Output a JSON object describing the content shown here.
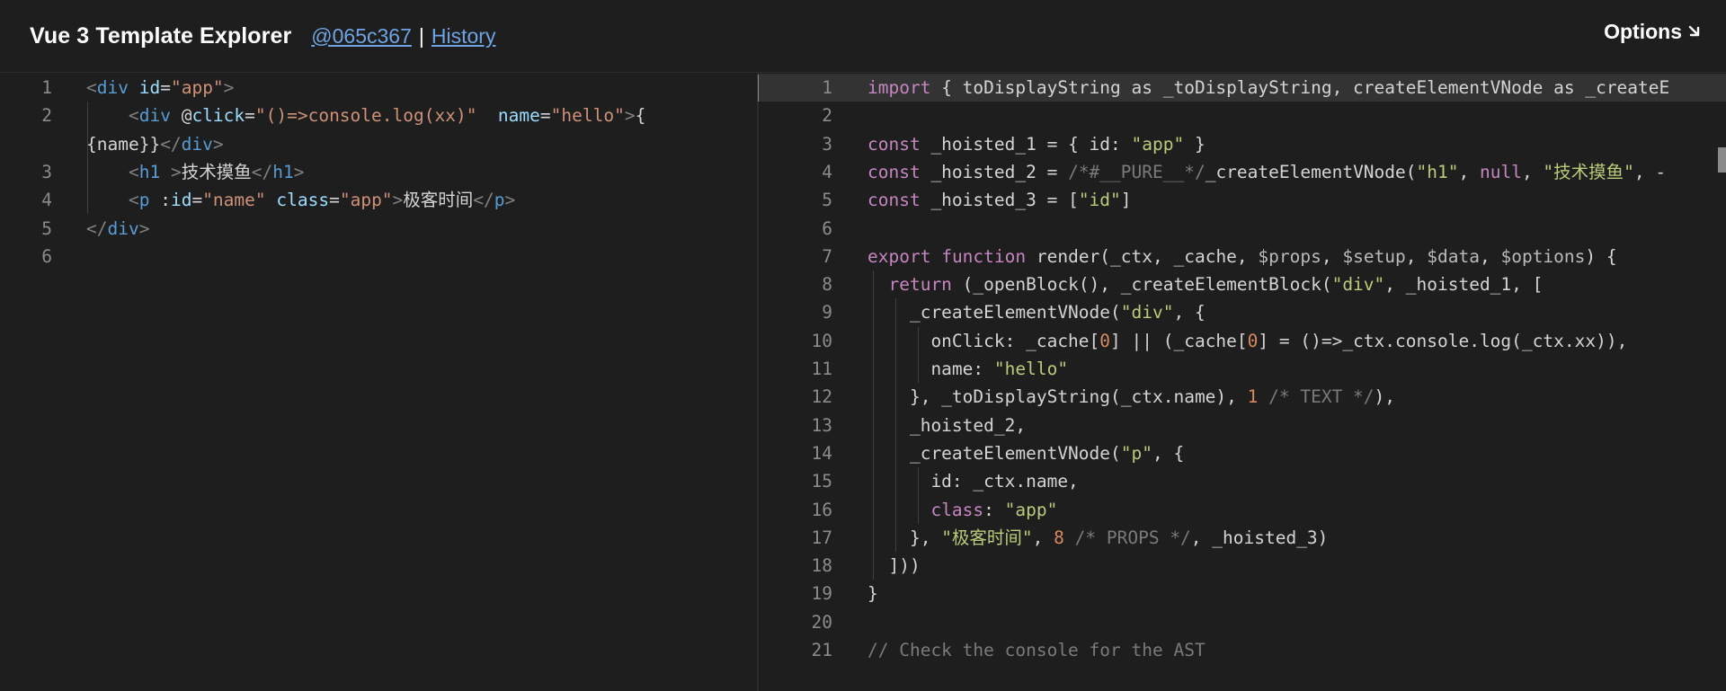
{
  "header": {
    "title": "Vue 3 Template Explorer",
    "commit": "@065c367",
    "separator": "|",
    "history": "History",
    "options": "Options",
    "options_icon": "arrow-down-right-icon"
  },
  "left_editor": {
    "line_numbers": [
      "1",
      "2",
      "3",
      "4",
      "5",
      "6"
    ],
    "lines": [
      [
        {
          "t": "br",
          "s": "<"
        },
        {
          "t": "tag",
          "s": "div"
        },
        {
          "t": "plain",
          "s": " "
        },
        {
          "t": "attr",
          "s": "id"
        },
        {
          "t": "plain",
          "s": "="
        },
        {
          "t": "str",
          "s": "\"app\""
        },
        {
          "t": "br",
          "s": ">"
        }
      ],
      [
        {
          "t": "plain",
          "s": "    "
        },
        {
          "t": "br",
          "s": "<"
        },
        {
          "t": "tag",
          "s": "div"
        },
        {
          "t": "plain",
          "s": " @"
        },
        {
          "t": "attr",
          "s": "click"
        },
        {
          "t": "plain",
          "s": "="
        },
        {
          "t": "str",
          "s": "\"()=>console.log(xx)\""
        },
        {
          "t": "plain",
          "s": "  "
        },
        {
          "t": "attr",
          "s": "name"
        },
        {
          "t": "plain",
          "s": "="
        },
        {
          "t": "str",
          "s": "\"hello\""
        },
        {
          "t": "br",
          "s": ">"
        },
        {
          "t": "plain",
          "s": "{"
        }
      ],
      [
        {
          "t": "plain",
          "s": "{name}}"
        },
        {
          "t": "br",
          "s": "</"
        },
        {
          "t": "tag",
          "s": "div"
        },
        {
          "t": "br",
          "s": ">"
        }
      ],
      [
        {
          "t": "plain",
          "s": "    "
        },
        {
          "t": "br",
          "s": "<"
        },
        {
          "t": "tag",
          "s": "h1"
        },
        {
          "t": "plain",
          "s": " "
        },
        {
          "t": "br",
          "s": ">"
        },
        {
          "t": "plain",
          "s": "技术摸鱼"
        },
        {
          "t": "br",
          "s": "</"
        },
        {
          "t": "tag",
          "s": "h1"
        },
        {
          "t": "br",
          "s": ">"
        }
      ],
      [
        {
          "t": "plain",
          "s": "    "
        },
        {
          "t": "br",
          "s": "<"
        },
        {
          "t": "tag",
          "s": "p"
        },
        {
          "t": "plain",
          "s": " :"
        },
        {
          "t": "attr",
          "s": "id"
        },
        {
          "t": "plain",
          "s": "="
        },
        {
          "t": "str",
          "s": "\"name\""
        },
        {
          "t": "plain",
          "s": " "
        },
        {
          "t": "attr",
          "s": "class"
        },
        {
          "t": "plain",
          "s": "="
        },
        {
          "t": "str",
          "s": "\"app\""
        },
        {
          "t": "br",
          "s": ">"
        },
        {
          "t": "plain",
          "s": "极客时间"
        },
        {
          "t": "br",
          "s": "</"
        },
        {
          "t": "tag",
          "s": "p"
        },
        {
          "t": "br",
          "s": ">"
        }
      ],
      [
        {
          "t": "br",
          "s": "</"
        },
        {
          "t": "tag",
          "s": "div"
        },
        {
          "t": "br",
          "s": ">"
        }
      ],
      []
    ]
  },
  "right_editor": {
    "line_numbers": [
      "1",
      "2",
      "3",
      "4",
      "5",
      "6",
      "7",
      "8",
      "9",
      "10",
      "11",
      "12",
      "13",
      "14",
      "15",
      "16",
      "17",
      "18",
      "19",
      "20",
      "21"
    ],
    "lines": [
      [
        {
          "t": "kw",
          "s": "import"
        },
        {
          "t": "plain",
          "s": " { toDisplayString as _toDisplayString, createElementVNode as _createE"
        }
      ],
      [],
      [
        {
          "t": "kw",
          "s": "const"
        },
        {
          "t": "plain",
          "s": " _hoisted_1 = { id: "
        },
        {
          "t": "jsstr",
          "s": "\"app\""
        },
        {
          "t": "plain",
          "s": " }"
        }
      ],
      [
        {
          "t": "kw",
          "s": "const"
        },
        {
          "t": "plain",
          "s": " _hoisted_2 = "
        },
        {
          "t": "cmt",
          "s": "/*#__PURE__*/"
        },
        {
          "t": "plain",
          "s": "_createElementVNode("
        },
        {
          "t": "jsstr",
          "s": "\"h1\""
        },
        {
          "t": "plain",
          "s": ", "
        },
        {
          "t": "kw",
          "s": "null"
        },
        {
          "t": "plain",
          "s": ", "
        },
        {
          "t": "jsstr",
          "s": "\"技术摸鱼\""
        },
        {
          "t": "plain",
          "s": ", -"
        }
      ],
      [
        {
          "t": "kw",
          "s": "const"
        },
        {
          "t": "plain",
          "s": " _hoisted_3 = ["
        },
        {
          "t": "jsstr",
          "s": "\"id\""
        },
        {
          "t": "plain",
          "s": "]"
        }
      ],
      [],
      [
        {
          "t": "kw",
          "s": "export"
        },
        {
          "t": "plain",
          "s": " "
        },
        {
          "t": "kw",
          "s": "function"
        },
        {
          "t": "plain",
          "s": " render(_ctx, _cache, "
        },
        {
          "t": "var",
          "s": "$props"
        },
        {
          "t": "plain",
          "s": ", "
        },
        {
          "t": "var",
          "s": "$setup"
        },
        {
          "t": "plain",
          "s": ", "
        },
        {
          "t": "var",
          "s": "$data"
        },
        {
          "t": "plain",
          "s": ", "
        },
        {
          "t": "var",
          "s": "$options"
        },
        {
          "t": "plain",
          "s": ") {"
        }
      ],
      [
        {
          "t": "plain",
          "s": "  "
        },
        {
          "t": "kw",
          "s": "return"
        },
        {
          "t": "plain",
          "s": " (_openBlock(), _createElementBlock("
        },
        {
          "t": "jsstr",
          "s": "\"div\""
        },
        {
          "t": "plain",
          "s": ", _hoisted_1, ["
        }
      ],
      [
        {
          "t": "plain",
          "s": "    _createElementVNode("
        },
        {
          "t": "jsstr",
          "s": "\"div\""
        },
        {
          "t": "plain",
          "s": ", {"
        }
      ],
      [
        {
          "t": "plain",
          "s": "      onClick: _cache["
        },
        {
          "t": "num",
          "s": "0"
        },
        {
          "t": "plain",
          "s": "] || (_cache["
        },
        {
          "t": "num",
          "s": "0"
        },
        {
          "t": "plain",
          "s": "] = ()=>_ctx.console.log(_ctx.xx)),"
        }
      ],
      [
        {
          "t": "plain",
          "s": "      name: "
        },
        {
          "t": "jsstr",
          "s": "\"hello\""
        }
      ],
      [
        {
          "t": "plain",
          "s": "    }, _toDisplayString(_ctx.name), "
        },
        {
          "t": "num",
          "s": "1"
        },
        {
          "t": "plain",
          "s": " "
        },
        {
          "t": "cmt",
          "s": "/* TEXT */"
        },
        {
          "t": "plain",
          "s": "),"
        }
      ],
      [
        {
          "t": "plain",
          "s": "    _hoisted_2,"
        }
      ],
      [
        {
          "t": "plain",
          "s": "    _createElementVNode("
        },
        {
          "t": "jsstr",
          "s": "\"p\""
        },
        {
          "t": "plain",
          "s": ", {"
        }
      ],
      [
        {
          "t": "plain",
          "s": "      id: _ctx.name,"
        }
      ],
      [
        {
          "t": "plain",
          "s": "      "
        },
        {
          "t": "kw",
          "s": "class"
        },
        {
          "t": "plain",
          "s": ": "
        },
        {
          "t": "jsstr",
          "s": "\"app\""
        }
      ],
      [
        {
          "t": "plain",
          "s": "    }, "
        },
        {
          "t": "jsstr",
          "s": "\"极客时间\""
        },
        {
          "t": "plain",
          "s": ", "
        },
        {
          "t": "num",
          "s": "8"
        },
        {
          "t": "plain",
          "s": " "
        },
        {
          "t": "cmt",
          "s": "/* PROPS */"
        },
        {
          "t": "plain",
          "s": ", _hoisted_3)"
        }
      ],
      [
        {
          "t": "plain",
          "s": "  ]))"
        }
      ],
      [
        {
          "t": "plain",
          "s": "}"
        }
      ],
      [],
      [
        {
          "t": "cmt",
          "s": "// Check the console for the AST"
        }
      ]
    ]
  }
}
